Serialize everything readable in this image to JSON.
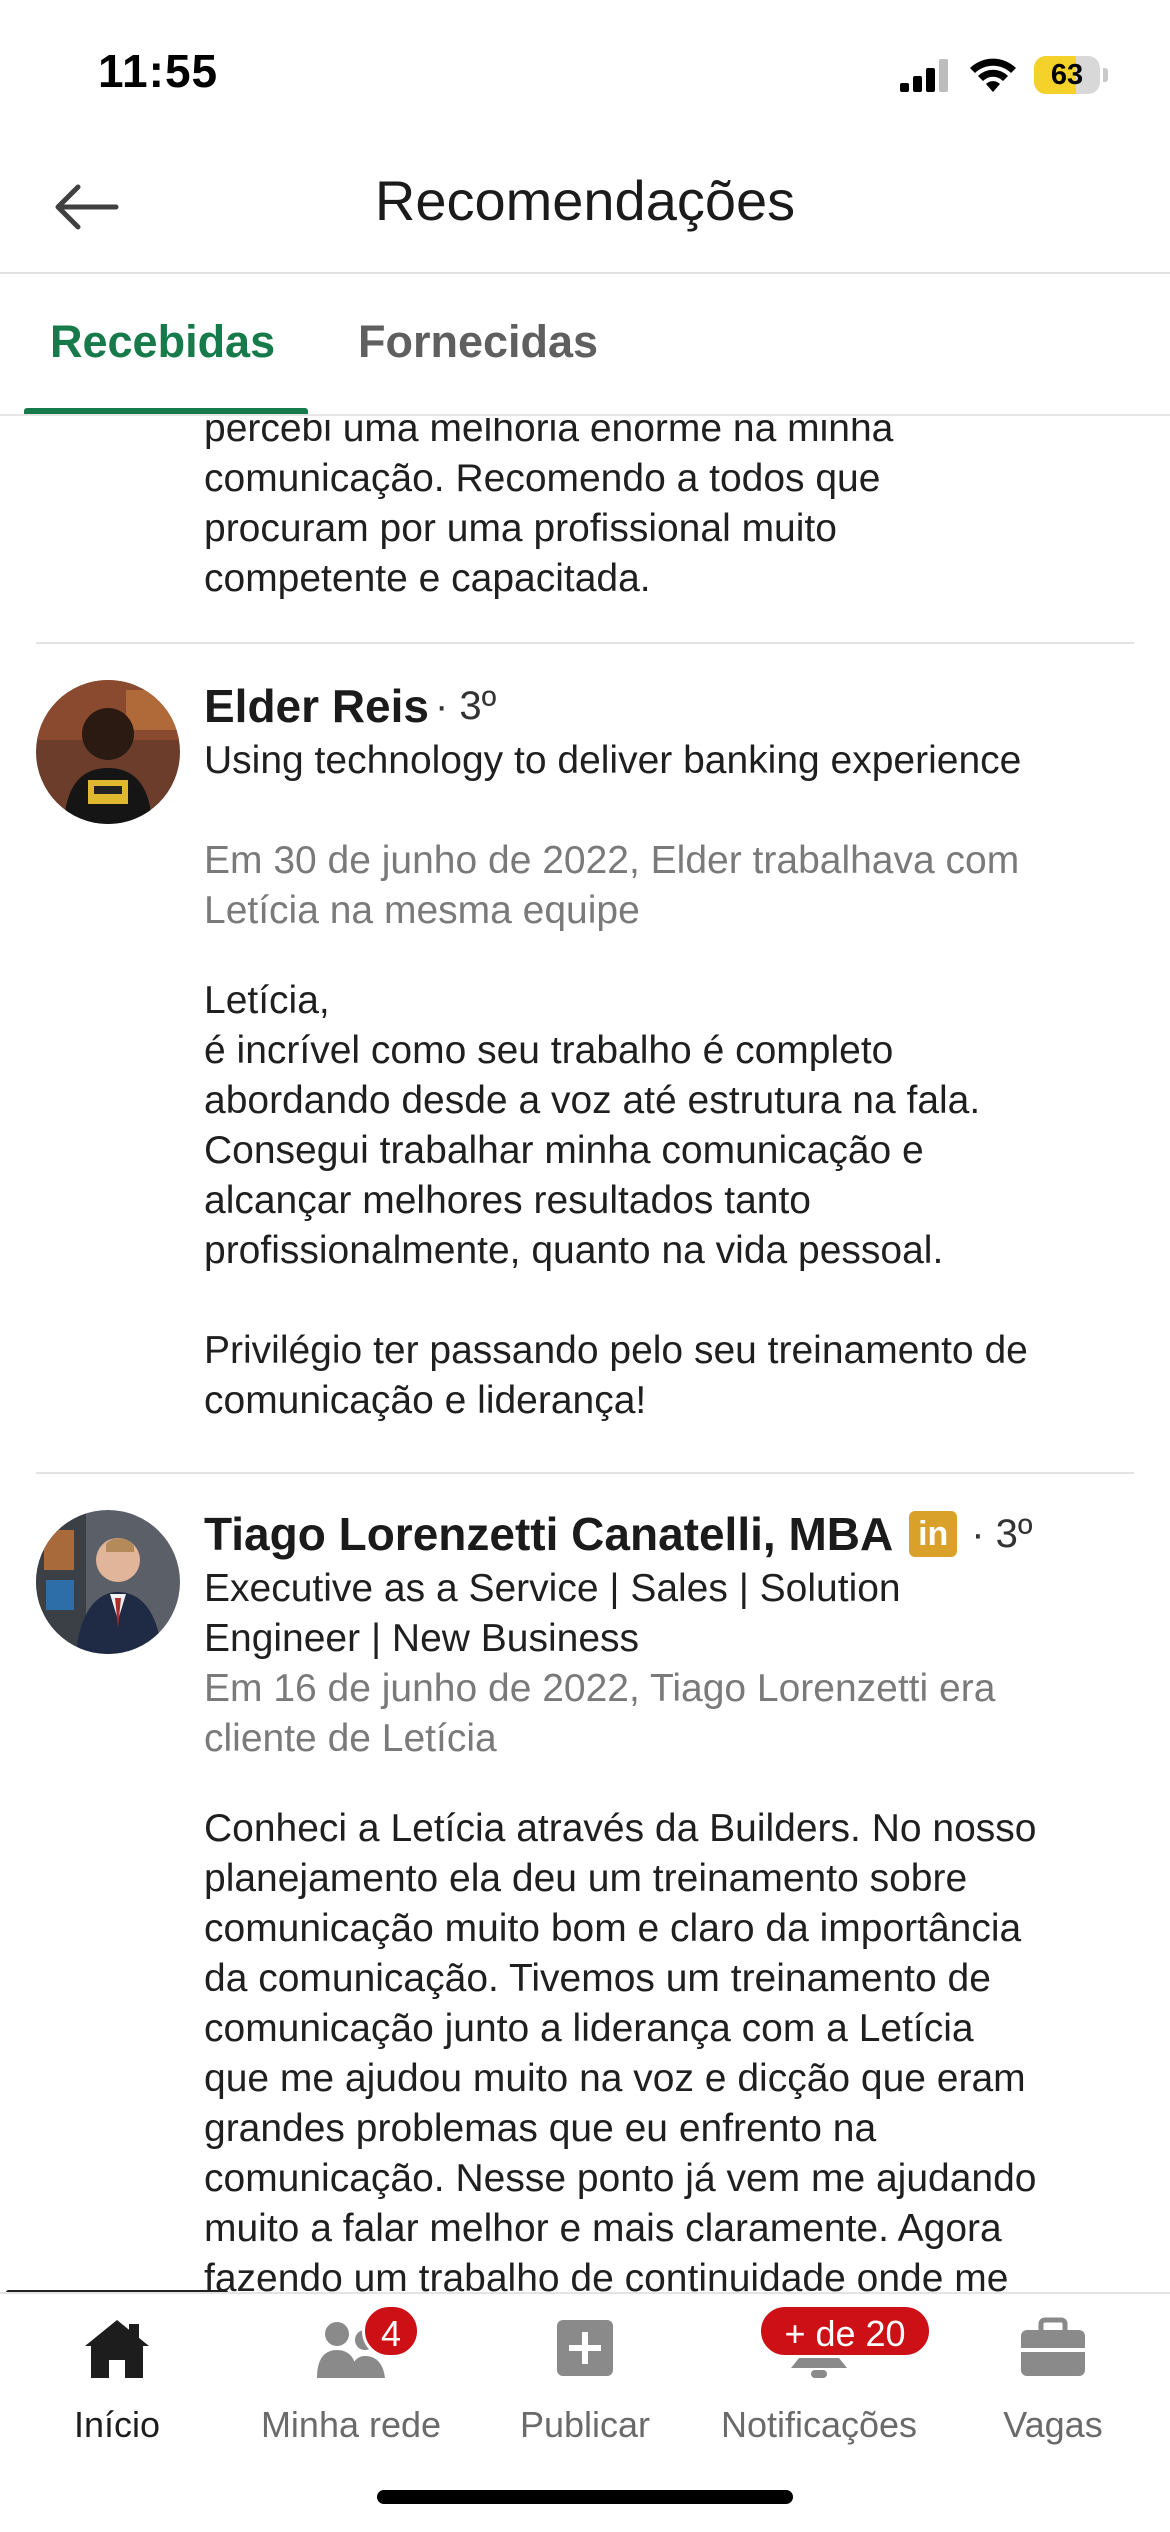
{
  "status_bar": {
    "time": "11:55",
    "battery": "63",
    "battery_level": 0.63
  },
  "header": {
    "title": "Recomendações"
  },
  "tabs": [
    {
      "label": "Recebidas",
      "active": true
    },
    {
      "label": "Fornecidas",
      "active": false
    }
  ],
  "partial_recommendation": {
    "text": "percebi uma melhoria enorme na minha\ncomunicação. Recomendo a todos que\nprocuram por uma profissional muito\ncompetente e capacitada."
  },
  "recommendations": [
    {
      "name": "Elder Reis",
      "degree": "· 3º",
      "headline": "Using technology to deliver banking experience",
      "relation": "Em 30 de junho de 2022, Elder trabalhava com\nLetícia na mesma equipe",
      "text": "Letícia,\né incrível como seu trabalho é completo\nabordando desde a voz até estrutura na fala.\nConsegui trabalhar minha comunicação e\nalcançar melhores resultados tanto\nprofissionalmente, quanto na vida pessoal.\n\nPrivilégio ter passando pelo seu treinamento de\ncomunicação e liderança!"
    },
    {
      "name": "Tiago Lorenzetti Canatelli, MBA",
      "badge_icon": "linkedin-in-icon",
      "badge_text": "in",
      "degree": "· 3º",
      "headline": "Executive as a Service | Sales | Solution\nEngineer | New Business",
      "relation": "Em 16 de junho de 2022, Tiago Lorenzetti era\ncliente de Letícia",
      "text": "Conheci a Letícia através da Builders. No nosso\nplanejamento ela deu um treinamento sobre\ncomunicação muito bom e claro da importância\nda comunicação. Tivemos um treinamento de\ncomunicação junto a liderança com a Letícia\nque me ajudou muito na voz e dicção que eram\ngrandes problemas que eu enfrento na\ncomunicação. Nesse ponto já vem me ajudando\nmuito a falar melhor e mais claramente. Agora\nfazendo um trabalho de continuidade onde me"
    }
  ],
  "bottom_nav": [
    {
      "label": "Início",
      "icon": "home-icon",
      "active": true
    },
    {
      "label": "Minha rede",
      "icon": "people-icon",
      "badge": "4"
    },
    {
      "label": "Publicar",
      "icon": "plus-square-icon"
    },
    {
      "label": "Notificações",
      "icon": "bell-icon",
      "badge": "+ de 20"
    },
    {
      "label": "Vagas",
      "icon": "briefcase-icon"
    }
  ],
  "colors": {
    "accent": "#167a4a",
    "badge": "#cc1016",
    "linkedin_badge": "#d9a02a"
  }
}
